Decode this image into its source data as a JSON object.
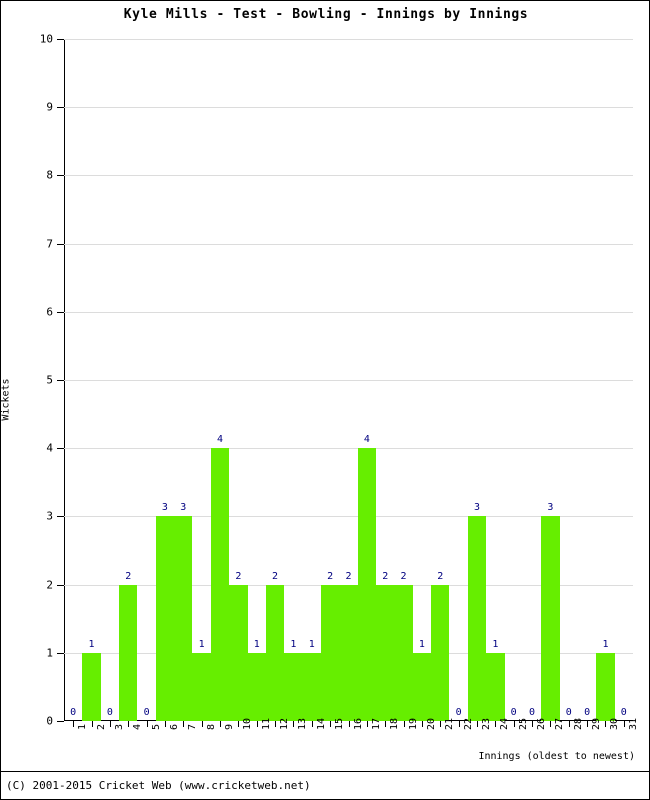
{
  "chart_data": {
    "type": "bar",
    "title": "Kyle Mills - Test - Bowling - Innings by Innings",
    "xlabel": "Innings (oldest to newest)",
    "ylabel": "Wickets",
    "ylim": [
      0,
      10
    ],
    "ytick_labels": [
      "0",
      "1",
      "2",
      "3",
      "4",
      "5",
      "6",
      "7",
      "8",
      "9",
      "10"
    ],
    "grid": true,
    "legend": null,
    "bar_color": "#66ee00",
    "value_label_color": "#000080",
    "categories": [
      "1",
      "2",
      "3",
      "4",
      "5",
      "6",
      "7",
      "8",
      "9",
      "10",
      "11",
      "12",
      "13",
      "14",
      "15",
      "16",
      "17",
      "18",
      "19",
      "20",
      "21",
      "22",
      "23",
      "24",
      "25",
      "26",
      "27",
      "28",
      "29",
      "30",
      "31"
    ],
    "values": [
      0,
      1,
      0,
      2,
      0,
      3,
      3,
      1,
      4,
      2,
      1,
      2,
      1,
      1,
      2,
      2,
      4,
      2,
      2,
      1,
      2,
      0,
      3,
      1,
      0,
      0,
      3,
      0,
      0,
      1,
      0
    ],
    "value_labels": [
      "0",
      "1",
      "0",
      "2",
      "0",
      "3",
      "3",
      "1",
      "4",
      "2",
      "1",
      "2",
      "1",
      "1",
      "2",
      "2",
      "4",
      "2",
      "2",
      "1",
      "2",
      "0",
      "3",
      "1",
      "0",
      "0",
      "3",
      "0",
      "0",
      "1",
      "0"
    ]
  },
  "footer": {
    "copyright": "(C) 2001-2015 Cricket Web (www.cricketweb.net)"
  }
}
